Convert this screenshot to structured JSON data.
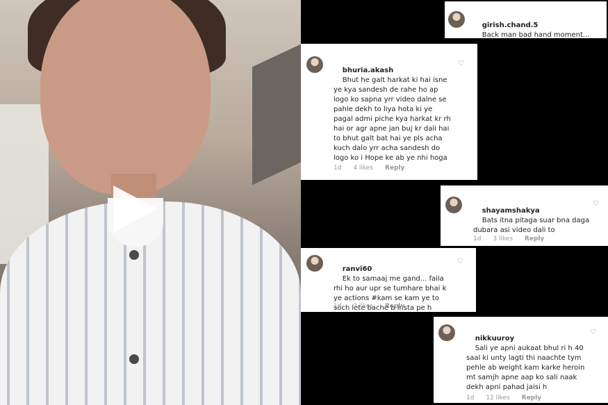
{
  "video": {
    "play_icon": "play-icon"
  },
  "comments": [
    {
      "username": "girish.chand.5",
      "text": "Back man bad hand moment..."
    },
    {
      "username": "bhuria.akash",
      "text": "Bhut he galt harkat ki hai isne ye kya sandesh de rahe ho ap logo ko sapna yrr video dalne se pahle dekh to liya hota ki ye pagal admi piche kya harkat kr rh hai or agr apne jan buj kr dali hai to bhut galt bat hai ye pls acha kuch dalo yrr acha sandesh do logo ko i Hope ke ab ye nhi hoga",
      "time": "1d",
      "likes": "4 likes",
      "reply": "Reply"
    },
    {
      "username": "shayamshakya",
      "text": "Bats itna pitaga suar bna daga dubara asi video dali to",
      "time": "1d",
      "likes": "3 likes",
      "reply": "Reply"
    },
    {
      "username": "ranvi60",
      "text": "Ek to samaaj me gand... faila rhi ho aur upr se tumhare bhai k ye actions #kam se kam ye to soch lete bache b insta pe h",
      "time": "1d",
      "likes": "2 likes",
      "reply": "Reply"
    },
    {
      "username": "nikkuuroy",
      "text": "Sali ye apni aukaat bhul ri h 40 saal ki unty lagti thi naachte tym pehle ab weight kam karke heroin mt samjh apne aap ko sali naak dekh apni pahad jaisi h",
      "time": "1d",
      "likes": "12 likes",
      "reply": "Reply"
    }
  ]
}
